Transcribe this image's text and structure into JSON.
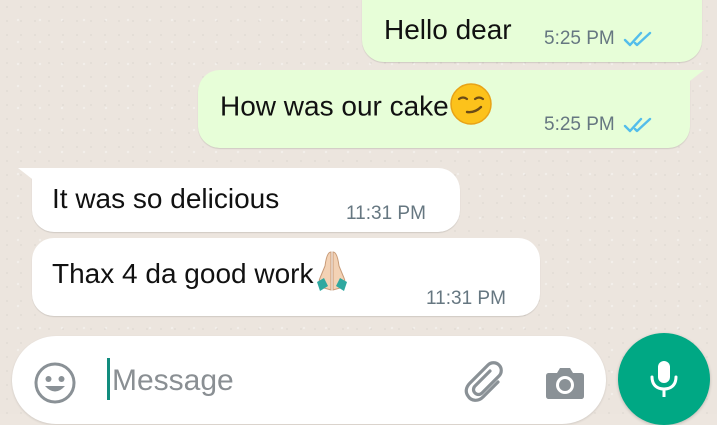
{
  "colors": {
    "outgoing_bubble": "#e7fed8",
    "incoming_bubble": "#ffffff",
    "read_ticks": "#53bdeb",
    "accent": "#00a884"
  },
  "messages": [
    {
      "direction": "outgoing",
      "text": "Hello dear",
      "time": "5:25 PM",
      "status": "read",
      "emoji": ""
    },
    {
      "direction": "outgoing",
      "text": "How was our cake",
      "time": "5:25 PM",
      "status": "read",
      "emoji": "smirking-face"
    },
    {
      "direction": "incoming",
      "text": "It was so delicious",
      "time": "11:31 PM",
      "emoji": ""
    },
    {
      "direction": "incoming",
      "text": "Thax 4 da good work",
      "time": "11:31 PM",
      "emoji": "folded-hands"
    }
  ],
  "composer": {
    "placeholder": "Message",
    "value": "",
    "icons": [
      "emoji-icon",
      "paperclip-icon",
      "camera-icon",
      "microphone-icon"
    ]
  }
}
